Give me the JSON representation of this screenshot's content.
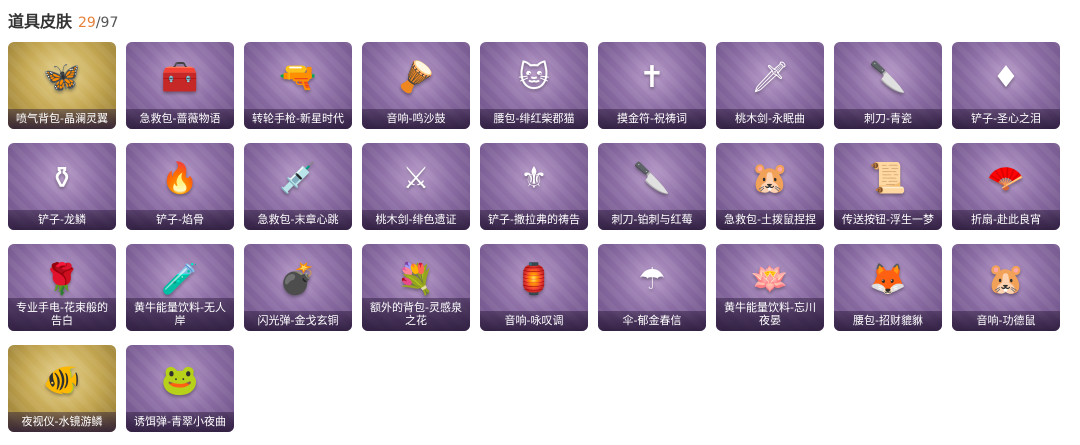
{
  "header": {
    "title": "道具皮肤",
    "owned": "29",
    "total": "/97"
  },
  "items": [
    {
      "label": "喷气背包-晶澜灵翼",
      "icon": "wings-icon",
      "glyph": "🦋",
      "gold": true
    },
    {
      "label": "急救包-蔷薇物语",
      "icon": "medkit-icon",
      "glyph": "🧰"
    },
    {
      "label": "转轮手枪-新星时代",
      "icon": "revolver-icon",
      "glyph": "🔫"
    },
    {
      "label": "音响-鸣沙鼓",
      "icon": "drum-icon",
      "glyph": "🪘"
    },
    {
      "label": "腰包-绯红柴郡猫",
      "icon": "cat-bag-icon",
      "glyph": "🐱"
    },
    {
      "label": "摸金符-祝祷词",
      "icon": "charm-icon",
      "glyph": "✝"
    },
    {
      "label": "桃木剑-永眠曲",
      "icon": "sword-icon",
      "glyph": "🗡"
    },
    {
      "label": "刺刀-青瓷",
      "icon": "blade-icon",
      "glyph": "🔪"
    },
    {
      "label": "铲子-圣心之泪",
      "icon": "shovel-icon",
      "glyph": "♦"
    },
    {
      "label": "铲子-龙鳞",
      "icon": "shovel-icon",
      "glyph": "⚱"
    },
    {
      "label": "铲子-焰骨",
      "icon": "shovel-icon",
      "glyph": "🔥"
    },
    {
      "label": "急救包-末章心跳",
      "icon": "syringe-icon",
      "glyph": "💉"
    },
    {
      "label": "桃木剑-绯色遗证",
      "icon": "sword-icon",
      "glyph": "⚔"
    },
    {
      "label": "铲子-撒拉弗的祷告",
      "icon": "shovel-icon",
      "glyph": "⚜"
    },
    {
      "label": "刺刀-铂刺与红莓",
      "icon": "blade-icon",
      "glyph": "🔪"
    },
    {
      "label": "急救包-土拨鼠捏捏",
      "icon": "marmot-icon",
      "glyph": "🐹"
    },
    {
      "label": "传送按钮-浮生一梦",
      "icon": "scroll-icon",
      "glyph": "📜"
    },
    {
      "label": "折扇-赴此良宵",
      "icon": "fan-icon",
      "glyph": "🪭"
    },
    {
      "label": "专业手电-花束般的告白",
      "icon": "rose-icon",
      "glyph": "🌹",
      "two": true
    },
    {
      "label": "黄牛能量饮料-无人岸",
      "icon": "potion-icon",
      "glyph": "🧪",
      "two": true
    },
    {
      "label": "闪光弹-金戈玄铜",
      "icon": "grenade-icon",
      "glyph": "💣"
    },
    {
      "label": "额外的背包-灵感泉之花",
      "icon": "bouquet-icon",
      "glyph": "💐",
      "two": true
    },
    {
      "label": "音响-咏叹调",
      "icon": "lantern-icon",
      "glyph": "🏮"
    },
    {
      "label": "伞-郁金春信",
      "icon": "umbrella-icon",
      "glyph": "☂"
    },
    {
      "label": "黄牛能量饮料-忘川夜晏",
      "icon": "lotus-icon",
      "glyph": "🪷",
      "two": true
    },
    {
      "label": "腰包-招财貔貅",
      "icon": "pixiu-icon",
      "glyph": "🦊"
    },
    {
      "label": "音响-功德鼠",
      "icon": "mouse-icon",
      "glyph": "🐹"
    },
    {
      "label": "夜视仪-水镜游鳞",
      "icon": "fishbowl-icon",
      "glyph": "🐠",
      "gold": true
    },
    {
      "label": "诱饵弹-青翠小夜曲",
      "icon": "frog-icon",
      "glyph": "🐸"
    }
  ]
}
